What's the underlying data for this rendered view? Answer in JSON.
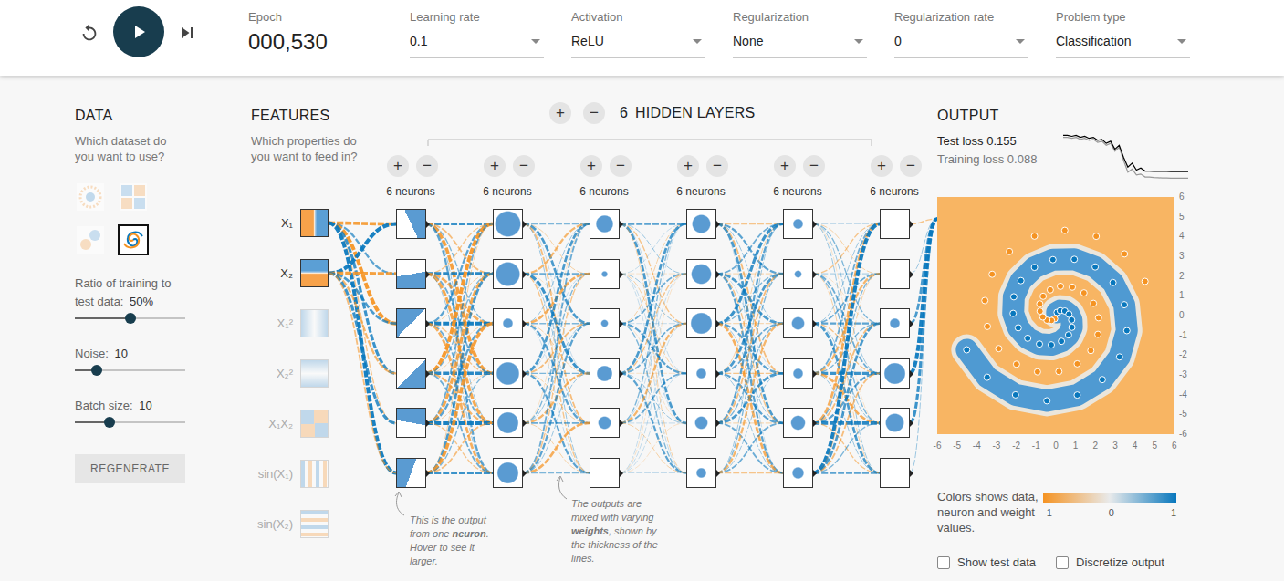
{
  "toolbar": {
    "epoch": {
      "label": "Epoch",
      "value": "000,530"
    },
    "controls": [
      {
        "label": "Learning rate",
        "value": "0.1"
      },
      {
        "label": "Activation",
        "value": "ReLU"
      },
      {
        "label": "Regularization",
        "value": "None"
      },
      {
        "label": "Regularization rate",
        "value": "0"
      },
      {
        "label": "Problem type",
        "value": "Classification"
      }
    ]
  },
  "data_panel": {
    "title": "DATA",
    "description": "Which dataset do you want to use?",
    "datasets": [
      {
        "kind": "circle",
        "selected": false
      },
      {
        "kind": "xor",
        "selected": false
      },
      {
        "kind": "gauss",
        "selected": false
      },
      {
        "kind": "spiral",
        "selected": true
      }
    ],
    "sliders": [
      {
        "label": "Ratio of training to test data:",
        "value": "50%",
        "level": 0.5
      },
      {
        "label": "Noise:",
        "value": "10",
        "level": 0.2
      },
      {
        "label": "Batch size:",
        "value": "10",
        "level": 0.31
      }
    ],
    "button": "REGENERATE"
  },
  "features_panel": {
    "title": "FEATURES",
    "description": "Which properties do you want to feed in?",
    "features": [
      {
        "label": "X₁",
        "kind": "vsplit",
        "enabled": true
      },
      {
        "label": "X₂",
        "kind": "hsplit",
        "enabled": true
      },
      {
        "label": "X₁²",
        "kind": "vbands",
        "enabled": false
      },
      {
        "label": "X₂²",
        "kind": "hbands",
        "enabled": false
      },
      {
        "label": "X₁X₂",
        "kind": "quadrants",
        "enabled": false
      },
      {
        "label": "sin(X₁)",
        "kind": "vstripes",
        "enabled": false
      },
      {
        "label": "sin(X₂)",
        "kind": "hstripes",
        "enabled": false
      }
    ]
  },
  "network": {
    "add": "+",
    "remove": "−",
    "count": "6",
    "label": "HIDDEN LAYERS",
    "layers": [
      {
        "label": "6 neurons",
        "neurons": [
          {
            "kind": "plane",
            "angle": 65
          },
          {
            "kind": "plane",
            "angle": 170
          },
          {
            "kind": "plane",
            "angle": 315
          },
          {
            "kind": "plane",
            "angle": 135
          },
          {
            "kind": "plane",
            "angle": 10
          },
          {
            "kind": "plane",
            "angle": 290
          }
        ]
      },
      {
        "label": "6 neurons",
        "neurons": [
          {
            "kind": "blob",
            "level": 0.85
          },
          {
            "kind": "blob",
            "level": 0.8
          },
          {
            "kind": "blob",
            "level": 0.3
          },
          {
            "kind": "blob",
            "level": 0.75
          },
          {
            "kind": "blob",
            "level": 0.7
          },
          {
            "kind": "blob",
            "level": 0.7
          }
        ]
      },
      {
        "label": "6 neurons",
        "neurons": [
          {
            "kind": "blob",
            "level": 0.55
          },
          {
            "kind": "blob",
            "level": 0.15
          },
          {
            "kind": "blob",
            "level": 0.2
          },
          {
            "kind": "blob",
            "level": 0.5
          },
          {
            "kind": "blob",
            "level": 0.4
          },
          {
            "kind": "blob",
            "level": 0
          }
        ]
      },
      {
        "label": "6 neurons",
        "neurons": [
          {
            "kind": "blob",
            "level": 0.6
          },
          {
            "kind": "blob",
            "level": 0.65
          },
          {
            "kind": "blob",
            "level": 0.7
          },
          {
            "kind": "blob",
            "level": 0.3
          },
          {
            "kind": "blob",
            "level": 0.4
          },
          {
            "kind": "blob",
            "level": 0.3
          }
        ]
      },
      {
        "label": "6 neurons",
        "neurons": [
          {
            "kind": "blob",
            "level": 0.3
          },
          {
            "kind": "blob",
            "level": 0.2
          },
          {
            "kind": "blob",
            "level": 0.4
          },
          {
            "kind": "blob",
            "level": 0.3
          },
          {
            "kind": "blob",
            "level": 0.45
          },
          {
            "kind": "blob",
            "level": 0.35
          }
        ]
      },
      {
        "label": "6 neurons",
        "neurons": [
          {
            "kind": "blob",
            "level": 0
          },
          {
            "kind": "blob",
            "level": 0
          },
          {
            "kind": "blob",
            "level": 0.3
          },
          {
            "kind": "blob",
            "level": 0.7
          },
          {
            "kind": "blob",
            "level": 0.6
          },
          {
            "kind": "blob",
            "level": 0
          }
        ]
      }
    ],
    "weights": [
      [
        [
          -0.8,
          0.5,
          -0.9,
          0.7,
          -0.3,
          0.9
        ],
        [
          0.9,
          -0.8,
          0.6,
          -0.5,
          0.7,
          -0.4
        ]
      ],
      [
        [
          0.7,
          -0.4,
          0.3,
          -0.8,
          0.2,
          0.5
        ],
        [
          -0.3,
          0.8,
          -0.6,
          0.4,
          -0.7,
          0.2
        ],
        [
          0.5,
          -0.2,
          0.9,
          -0.3,
          0.4,
          -0.6
        ],
        [
          -0.9,
          0.3,
          -0.2,
          0.8,
          -0.5,
          0.4
        ],
        [
          0.4,
          -0.7,
          0.5,
          -0.2,
          0.9,
          -0.3
        ],
        [
          -0.2,
          0.6,
          -0.8,
          0.3,
          -0.4,
          0.7
        ]
      ],
      [
        [
          0.3,
          -0.2,
          0.6,
          0.1,
          -0.4,
          0.2
        ],
        [
          -0.5,
          0.4,
          -0.1,
          0.7,
          0.2,
          -0.3
        ],
        [
          0.2,
          -0.6,
          0.3,
          -0.2,
          0.5,
          0.1
        ],
        [
          0.6,
          0.1,
          -0.4,
          0.3,
          -0.2,
          0.5
        ],
        [
          -0.1,
          0.3,
          0.2,
          -0.5,
          0.4,
          -0.2
        ],
        [
          0.4,
          -0.3,
          0.5,
          0.2,
          -0.6,
          0.3
        ]
      ],
      [
        [
          0.5,
          0.2,
          -0.3,
          0.1,
          0.6,
          -0.2
        ],
        [
          0.1,
          -0.1,
          0.2,
          -0.2,
          0.1,
          0.1
        ],
        [
          -0.2,
          0.4,
          0.1,
          0.5,
          -0.1,
          0.3
        ],
        [
          0.6,
          -0.3,
          0.4,
          -0.1,
          0.2,
          0.5
        ],
        [
          0.3,
          0.1,
          -0.5,
          0.4,
          0.1,
          -0.2
        ],
        [
          0.1,
          -0.1,
          0.1,
          0.1,
          -0.1,
          0.1
        ]
      ],
      [
        [
          -0.3,
          0.5,
          0.2,
          -0.4,
          0.6,
          0.1
        ],
        [
          0.4,
          -0.2,
          0.6,
          0.1,
          -0.3,
          0.5
        ],
        [
          0.7,
          0.3,
          -0.2,
          0.5,
          0.2,
          -0.6
        ],
        [
          -0.2,
          0.6,
          0.4,
          -0.3,
          0.5,
          0.2
        ],
        [
          0.5,
          -0.4,
          0.3,
          0.6,
          -0.2,
          0.4
        ],
        [
          0.2,
          0.3,
          -0.5,
          0.2,
          0.4,
          -0.3
        ]
      ],
      [
        [
          0.1,
          -0.2,
          0.3,
          0.2,
          -0.1,
          0.2
        ],
        [
          -0.3,
          0.2,
          -0.1,
          0.4,
          0.3,
          -0.2
        ],
        [
          0.2,
          0.4,
          0.5,
          -0.3,
          0.2,
          0.6
        ],
        [
          0.4,
          -0.5,
          0.3,
          0.7,
          -0.6,
          0.2
        ],
        [
          -0.6,
          0.3,
          -0.4,
          0.5,
          0.8,
          -0.3
        ],
        [
          0.9,
          -0.2,
          0.6,
          -0.4,
          0.3,
          0.5
        ]
      ],
      [
        [
          -0.3
        ],
        [
          0.2
        ],
        [
          0.6
        ],
        [
          0.9
        ],
        [
          0.7
        ],
        [
          0.2
        ]
      ]
    ]
  },
  "annotations": [
    {
      "parts": [
        {
          "text": "This is the output from one ",
          "bold": false
        },
        {
          "text": "neuron",
          "bold": true
        },
        {
          "text": ". Hover to see it larger.",
          "bold": false
        }
      ]
    },
    {
      "parts": [
        {
          "text": "The outputs are mixed with varying ",
          "bold": false
        },
        {
          "text": "weights",
          "bold": true
        },
        {
          "text": ", shown by the thickness of the lines.",
          "bold": false
        }
      ]
    }
  ],
  "output": {
    "title": "OUTPUT",
    "test_loss": {
      "label": "Test loss",
      "value": "0.155"
    },
    "train_loss": {
      "label": "Training loss",
      "value": "0.088"
    },
    "loss_chart": {
      "test": [
        0.52,
        0.52,
        0.51,
        0.52,
        0.5,
        0.51,
        0.49,
        0.5,
        0.47,
        0.48,
        0.44,
        0.46,
        0.38,
        0.42,
        0.3,
        0.2,
        0.24,
        0.17,
        0.19,
        0.16,
        0.16,
        0.158,
        0.157,
        0.156,
        0.156,
        0.155,
        0.155,
        0.155,
        0.155,
        0.155
      ],
      "train": [
        0.5,
        0.5,
        0.49,
        0.5,
        0.48,
        0.49,
        0.47,
        0.48,
        0.45,
        0.46,
        0.42,
        0.44,
        0.36,
        0.4,
        0.27,
        0.15,
        0.18,
        0.12,
        0.13,
        0.1,
        0.1,
        0.095,
        0.093,
        0.091,
        0.09,
        0.089,
        0.088,
        0.088,
        0.088,
        0.088
      ]
    },
    "plot": {
      "x_ticks": [
        "-6",
        "-5",
        "-4",
        "-3",
        "-2",
        "-1",
        "0",
        "1",
        "2",
        "3",
        "4",
        "5",
        "6"
      ],
      "y_ticks": [
        "6",
        "5",
        "4",
        "3",
        "2",
        "1",
        "0",
        "-1",
        "-2",
        "-3",
        "-4",
        "-5",
        "-6"
      ],
      "series": [
        {
          "value": 1,
          "color": "#0877bd",
          "points": [
            [
              0.06,
              0.16
            ],
            [
              0.22,
              0.25
            ],
            [
              0.45,
              0.23
            ],
            [
              0.66,
              0.07
            ],
            [
              0.8,
              -0.22
            ],
            [
              0.81,
              -0.59
            ],
            [
              0.64,
              -0.98
            ],
            [
              0.28,
              -1.3
            ],
            [
              -0.23,
              -1.48
            ],
            [
              -0.83,
              -1.44
            ],
            [
              -1.42,
              -1.15
            ],
            [
              -1.9,
              -0.62
            ],
            [
              -2.16,
              0.11
            ],
            [
              -2.13,
              0.95
            ],
            [
              -1.77,
              1.77
            ],
            [
              -1.08,
              2.44
            ],
            [
              -0.15,
              2.83
            ],
            [
              0.93,
              2.85
            ],
            [
              1.99,
              2.46
            ],
            [
              2.89,
              1.67
            ],
            [
              3.46,
              0.55
            ],
            [
              3.59,
              -0.76
            ],
            [
              3.22,
              -2.09
            ],
            [
              2.35,
              -3.24
            ],
            [
              1.08,
              -4.02
            ],
            [
              -0.45,
              -4.31
            ],
            [
              -2.04,
              -4.01
            ],
            [
              -3.47,
              -3.12
            ],
            [
              -4.51,
              -1.73
            ]
          ]
        },
        {
          "value": -1,
          "color": "#f59322",
          "points": [
            [
              -0.06,
              -0.16
            ],
            [
              -0.22,
              -0.25
            ],
            [
              -0.45,
              -0.23
            ],
            [
              -0.66,
              -0.07
            ],
            [
              -0.8,
              0.22
            ],
            [
              -0.81,
              0.59
            ],
            [
              -0.64,
              0.98
            ],
            [
              -0.28,
              1.3
            ],
            [
              0.23,
              1.48
            ],
            [
              0.83,
              1.44
            ],
            [
              1.42,
              1.15
            ],
            [
              1.9,
              0.62
            ],
            [
              2.16,
              -0.11
            ],
            [
              2.13,
              -0.95
            ],
            [
              1.77,
              -1.77
            ],
            [
              1.08,
              -2.44
            ],
            [
              0.15,
              -2.83
            ],
            [
              -0.93,
              -2.85
            ],
            [
              -1.99,
              -2.46
            ],
            [
              -2.89,
              -1.67
            ],
            [
              -3.46,
              -0.55
            ],
            [
              -3.59,
              0.76
            ],
            [
              -3.22,
              2.09
            ],
            [
              -2.35,
              3.24
            ],
            [
              -1.08,
              4.02
            ],
            [
              0.45,
              4.31
            ],
            [
              2.04,
              4.01
            ],
            [
              3.47,
              3.12
            ],
            [
              4.51,
              1.73
            ]
          ]
        }
      ]
    },
    "legend": {
      "text": "Colors shows data, neuron and weight values.",
      "ticks": [
        "-1",
        "0",
        "1"
      ]
    },
    "checkboxes": [
      {
        "label": "Show test data",
        "checked": false
      },
      {
        "label": "Discretize output",
        "checked": false
      }
    ]
  }
}
